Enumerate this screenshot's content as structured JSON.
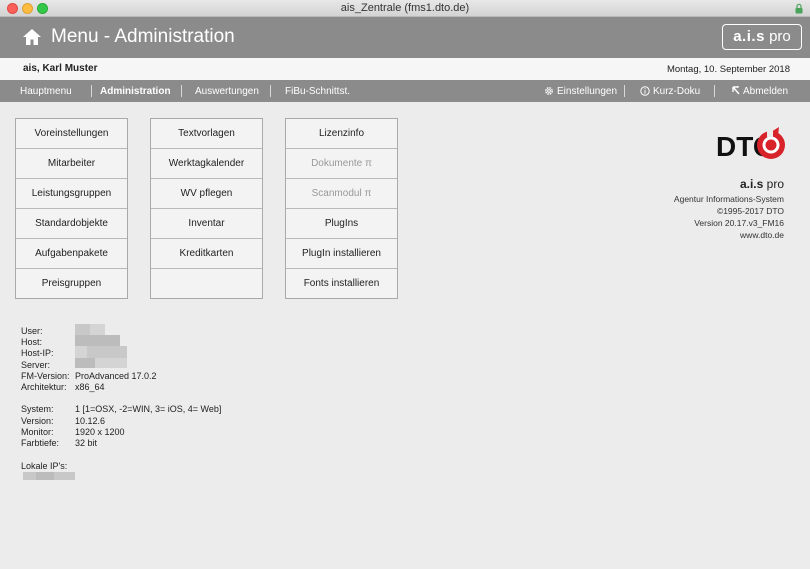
{
  "window": {
    "title": "ais_Zentrale (fms1.dto.de)"
  },
  "header": {
    "title": "Menu - Administration",
    "logo_bold": "a.i.s",
    "logo_light": " pro"
  },
  "user_row": {
    "user_name": "ais, Karl Muster",
    "date": "Montag, 10. September 2018"
  },
  "menu": {
    "left": [
      "Hauptmenu",
      "Administration",
      "Auswertungen",
      "FiBu-Schnittst."
    ],
    "right": [
      "Einstellungen",
      "Kurz-Doku",
      "Abmelden"
    ]
  },
  "columns": [
    [
      "Voreinstellungen",
      "Mitarbeiter",
      "Leistungsgruppen",
      "Standardobjekte",
      "Aufgabenpakete",
      "Preisgruppen"
    ],
    [
      "Textvorlagen",
      "Werktagkalender",
      "WV pflegen",
      "Inventar",
      "Kreditkarten",
      ""
    ],
    [
      "Lizenzinfo",
      "Dokumente π",
      "Scanmodul π",
      "PlugIns",
      "PlugIn installieren",
      "Fonts installieren"
    ]
  ],
  "info": {
    "logo_text": "DTO",
    "product_bold": "a.i.s",
    "product_light": " pro",
    "line1": "Agentur Informations-System",
    "line2": "©1995-2017 DTO",
    "line3": "Version 20.17.v3_FM16",
    "line4": "www.dto.de"
  },
  "system": {
    "user_label": "User:",
    "host_label": "Host:",
    "hostip_label": "Host-IP:",
    "server_label": "Server:",
    "fmversion_label": "FM-Version:",
    "fmversion_value": "ProAdvanced 17.0.2",
    "arch_label": "Architektur:",
    "arch_value": "x86_64",
    "system_label": "System:",
    "system_value": "1  [1=OSX, -2=WIN, 3= iOS, 4= Web]",
    "version_label": "Version:",
    "version_value": "10.12.6",
    "monitor_label": "Monitor:",
    "monitor_value": "1920 x 1200",
    "depth_label": "Farbtiefe:",
    "depth_value": "32 bit",
    "lokale_label": "Lokale IP's:"
  }
}
